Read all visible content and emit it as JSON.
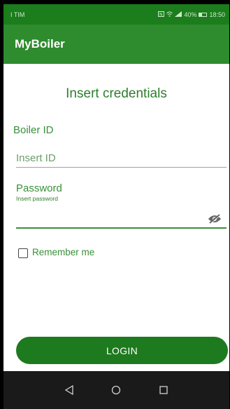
{
  "status_bar": {
    "carrier": "I TIM",
    "battery": "40%",
    "time": "18:50"
  },
  "app_bar": {
    "title": "MyBoiler"
  },
  "form": {
    "heading": "Insert credentials",
    "boiler_id_label": "Boiler ID",
    "boiler_id_placeholder": "Insert ID",
    "boiler_id_value": "",
    "password_label": "Password",
    "password_hint": "Insert password",
    "password_value": "",
    "remember_label": "Remember me",
    "remember_checked": false,
    "login_label": "LOGIN"
  },
  "icons": {
    "visibility_toggle": "eye-off-icon",
    "back": "back-triangle-icon",
    "home": "home-circle-icon",
    "recents": "recents-square-icon"
  },
  "colors": {
    "primary": "#2e8b2e",
    "primary_dark": "#1b7d1b",
    "accent_text": "#3a8f3a",
    "button": "#1e7a1e"
  }
}
